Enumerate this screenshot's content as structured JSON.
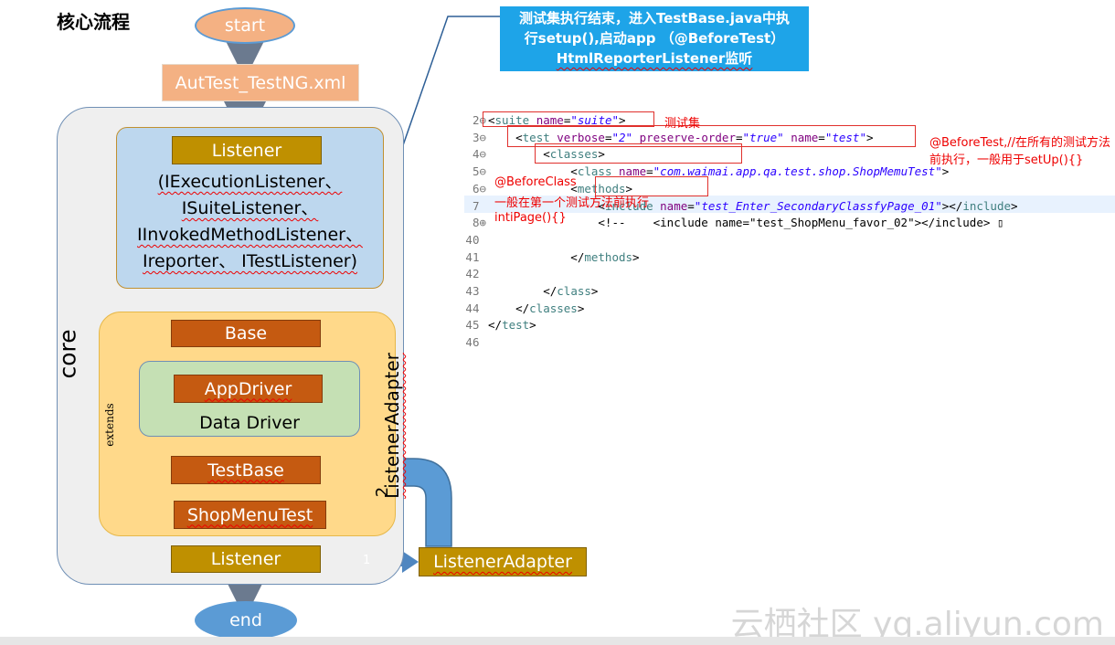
{
  "title": "核心流程",
  "flow": {
    "start": "start",
    "testng_xml": "AutTest_TestNG.xml",
    "core_label": "core",
    "listener_top": "Listener",
    "interfaces": [
      "(IExecutionListener、",
      "ISuiteListener、",
      "IInvokedMethodListener、",
      "Ireporter、 ITestListener)"
    ],
    "base": "Base",
    "app_driver": "AppDriver",
    "data_driver": "Data Driver",
    "extends_label": "extends",
    "test_base": "TestBase",
    "shop_menu_test": "ShopMenuTest",
    "listener_bottom": "Listener",
    "listener_adapter_box": "ListenerAdapter",
    "listener_adapter_vertical": "ListenerAdapter",
    "arrow_label_1": "1",
    "arrow_label_2": "2",
    "end": "end"
  },
  "callout": {
    "line1": "测试集执行结束，进入TestBase.java中执",
    "line2": "行setup(),启动app （@BeforeTest）",
    "line3": "HtmlReporterListener监听"
  },
  "code": {
    "lines": [
      {
        "num": "2",
        "fold": "⊖",
        "parts": [
          [
            "t",
            "<"
          ],
          [
            "k",
            "suite"
          ],
          [
            "t",
            " "
          ],
          [
            "a",
            "name"
          ],
          [
            "t",
            "="
          ],
          [
            "s",
            "\"suite\""
          ],
          [
            "t",
            ">"
          ]
        ]
      },
      {
        "num": "3",
        "fold": "⊖",
        "parts": [
          [
            "t",
            "    <"
          ],
          [
            "k",
            "test"
          ],
          [
            "t",
            " "
          ],
          [
            "a",
            "verbose"
          ],
          [
            "t",
            "="
          ],
          [
            "s",
            "\"2\""
          ],
          [
            "t",
            " "
          ],
          [
            "a",
            "preserve-order"
          ],
          [
            "t",
            "="
          ],
          [
            "s",
            "\"true\""
          ],
          [
            "t",
            " "
          ],
          [
            "a",
            "name"
          ],
          [
            "t",
            "="
          ],
          [
            "s",
            "\"test\""
          ],
          [
            "t",
            ">"
          ]
        ]
      },
      {
        "num": "4",
        "fold": "⊖",
        "parts": [
          [
            "t",
            "        <"
          ],
          [
            "k",
            "classes"
          ],
          [
            "t",
            ">"
          ]
        ]
      },
      {
        "num": "5",
        "fold": "⊖",
        "parts": [
          [
            "t",
            "            <"
          ],
          [
            "k",
            "class"
          ],
          [
            "t",
            " "
          ],
          [
            "a",
            "name"
          ],
          [
            "t",
            "="
          ],
          [
            "s",
            "\"com.waimai.app.qa.test.shop.ShopMemuTest\""
          ],
          [
            "t",
            ">"
          ]
        ]
      },
      {
        "num": "6",
        "fold": "⊖",
        "parts": [
          [
            "t",
            "            <"
          ],
          [
            "k",
            "methods"
          ],
          [
            "t",
            ">"
          ]
        ]
      },
      {
        "num": "7",
        "fold": "",
        "parts": [
          [
            "t",
            "                <"
          ],
          [
            "k",
            "include"
          ],
          [
            "t",
            " "
          ],
          [
            "a",
            "name"
          ],
          [
            "t",
            "="
          ],
          [
            "s",
            "\"test_Enter_SecondaryClassfyPage_01\""
          ],
          [
            "t",
            "></"
          ],
          [
            "k",
            "include"
          ],
          [
            "t",
            ">"
          ]
        ]
      },
      {
        "num": "8",
        "fold": "⊕",
        "parts": [
          [
            "t",
            "                <!--    <include name=\"test_ShopMenu_favor_02\"></include> ▯"
          ]
        ]
      },
      {
        "num": "40",
        "fold": "",
        "parts": [
          [
            "t",
            ""
          ]
        ]
      },
      {
        "num": "41",
        "fold": "",
        "parts": [
          [
            "t",
            "            </"
          ],
          [
            "k",
            "methods"
          ],
          [
            "t",
            ">"
          ]
        ]
      },
      {
        "num": "42",
        "fold": "",
        "parts": [
          [
            "t",
            ""
          ]
        ]
      },
      {
        "num": "43",
        "fold": "",
        "parts": [
          [
            "t",
            "        </"
          ],
          [
            "k",
            "class"
          ],
          [
            "t",
            ">"
          ]
        ]
      },
      {
        "num": "44",
        "fold": "",
        "parts": [
          [
            "t",
            "    </"
          ],
          [
            "k",
            "classes"
          ],
          [
            "t",
            ">"
          ]
        ]
      },
      {
        "num": "45",
        "fold": "",
        "parts": [
          [
            "t",
            "</"
          ],
          [
            "k",
            "test"
          ],
          [
            "t",
            ">"
          ]
        ]
      },
      {
        "num": "46",
        "fold": "",
        "parts": [
          [
            "t",
            ""
          ]
        ]
      }
    ]
  },
  "notes": {
    "suite_note": "测试集",
    "before_test_1": "@BeforeTest,//在所有的测试方法",
    "before_test_2": "前执行，一般用于setUp(){}",
    "before_class_1": "@BeforeClass",
    "before_class_2": "一般在第一个测试方法前执行",
    "before_class_3": "intiPage(){}"
  },
  "watermark": "云栖社区 yq.aliyun.com",
  "colors": {
    "blue": "#5b9bd5",
    "gold": "#bf9000",
    "rust": "#c55a11",
    "salmon": "#f4b183",
    "callout": "#1ea4e8",
    "red": "#e0302c"
  }
}
